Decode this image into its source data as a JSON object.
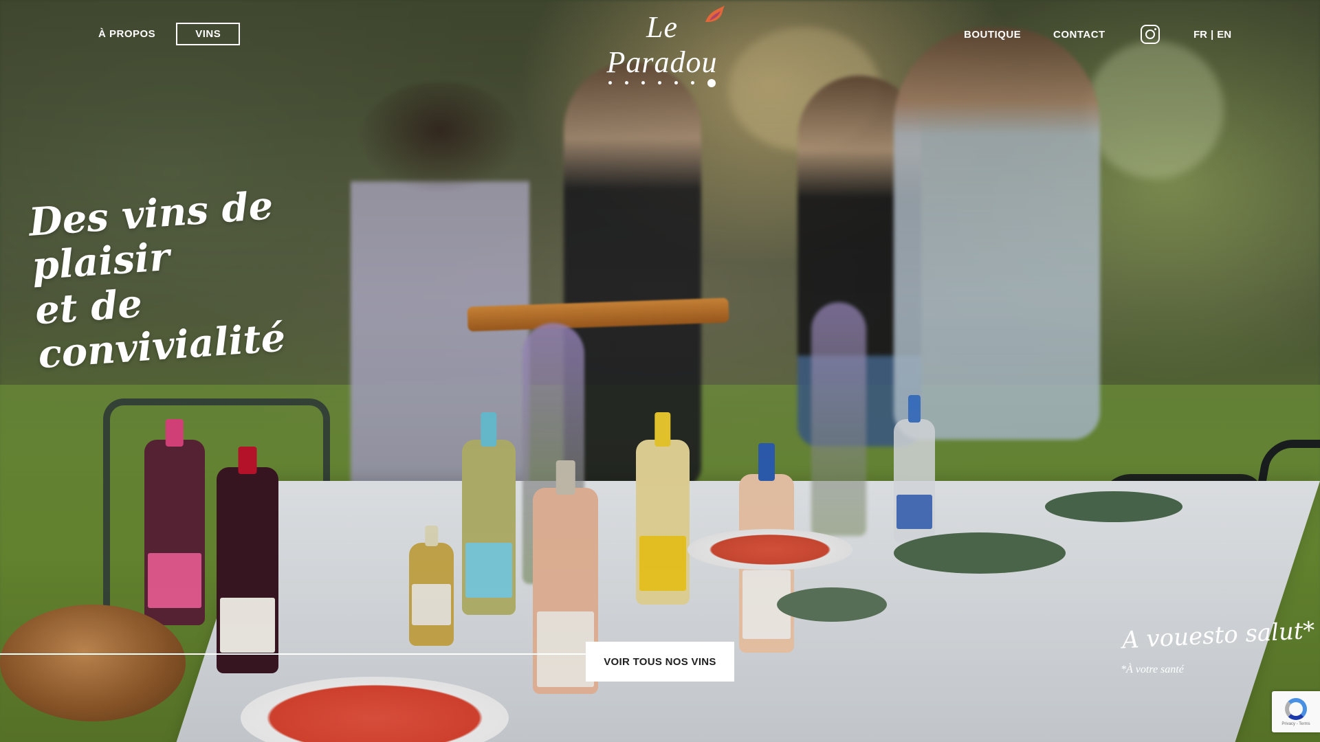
{
  "header": {
    "nav_left": [
      {
        "label": "À PROPOS"
      },
      {
        "label": "VINS"
      }
    ],
    "nav_right": [
      {
        "label": "BOUTIQUE"
      },
      {
        "label": "CONTACT"
      }
    ],
    "social_icon": "instagram-icon",
    "languages": {
      "fr": "FR",
      "separator": "|",
      "en": "EN"
    },
    "logo": {
      "text": "Le Paradou"
    },
    "carousel": {
      "total_slides": 7,
      "active_slide": 7
    }
  },
  "hero": {
    "headline_line1": "Des vins de plaisir",
    "headline_line2": "et de convivialité",
    "cta_label": "VOIR TOUS NOS VINS",
    "toast_main": "A vouesto salut*",
    "toast_sub": "*À votre santé"
  },
  "recaptcha": {
    "footer": "Privacy - Terms"
  },
  "colors": {
    "text": "#ffffff",
    "cta_bg": "#ffffff",
    "cta_text": "#1e1e1e",
    "logo_accent": "#e2683a"
  }
}
